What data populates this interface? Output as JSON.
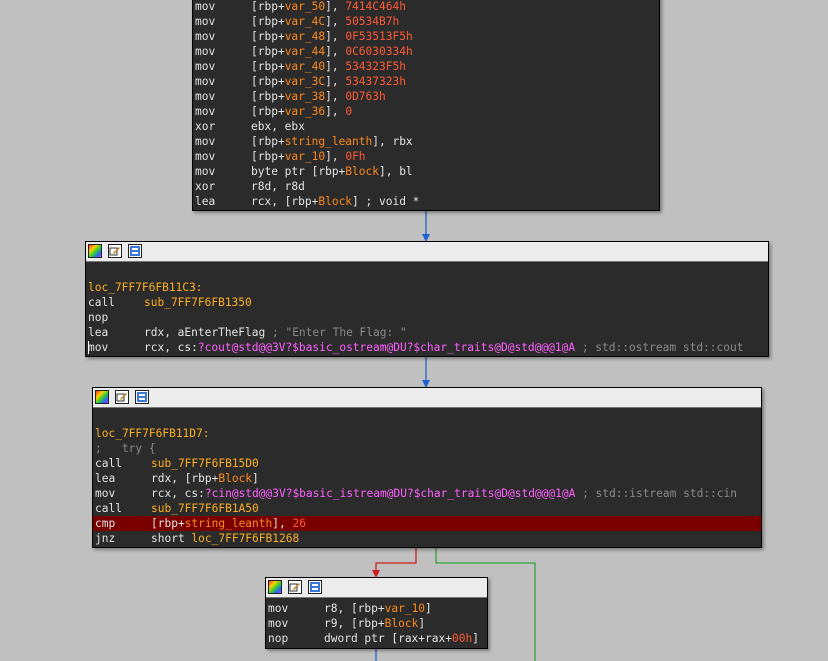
{
  "colors": {
    "background": "#c0c0c0",
    "block": "#2b2b2b",
    "edge_normal": "#1e62d0",
    "edge_false": "#cc1f1f",
    "edge_true": "#2fa43a",
    "highlight": "#7a0000"
  },
  "header_icons": [
    "graph-colors-icon",
    "edit-node-icon",
    "group-nodes-icon"
  ],
  "block1": {
    "lines": [
      {
        "mnem": "mov",
        "operands": [
          {
            "t": "[rbp+",
            "c": "op"
          },
          {
            "t": "var_50",
            "c": "var"
          },
          {
            "t": "], ",
            "c": "op"
          },
          {
            "t": "7414C464h",
            "c": "num"
          }
        ]
      },
      {
        "mnem": "mov",
        "operands": [
          {
            "t": "[rbp+",
            "c": "op"
          },
          {
            "t": "var_4C",
            "c": "var"
          },
          {
            "t": "], ",
            "c": "op"
          },
          {
            "t": "50534B7h",
            "c": "num"
          }
        ]
      },
      {
        "mnem": "mov",
        "operands": [
          {
            "t": "[rbp+",
            "c": "op"
          },
          {
            "t": "var_48",
            "c": "var"
          },
          {
            "t": "], ",
            "c": "op"
          },
          {
            "t": "0F53513F5h",
            "c": "num"
          }
        ]
      },
      {
        "mnem": "mov",
        "operands": [
          {
            "t": "[rbp+",
            "c": "op"
          },
          {
            "t": "var_44",
            "c": "var"
          },
          {
            "t": "], ",
            "c": "op"
          },
          {
            "t": "0C6030334h",
            "c": "num"
          }
        ]
      },
      {
        "mnem": "mov",
        "operands": [
          {
            "t": "[rbp+",
            "c": "op"
          },
          {
            "t": "var_40",
            "c": "var"
          },
          {
            "t": "], ",
            "c": "op"
          },
          {
            "t": "534323F5h",
            "c": "num"
          }
        ]
      },
      {
        "mnem": "mov",
        "operands": [
          {
            "t": "[rbp+",
            "c": "op"
          },
          {
            "t": "var_3C",
            "c": "var"
          },
          {
            "t": "], ",
            "c": "op"
          },
          {
            "t": "53437323h",
            "c": "num"
          }
        ]
      },
      {
        "mnem": "mov",
        "operands": [
          {
            "t": "[rbp+",
            "c": "op"
          },
          {
            "t": "var_38",
            "c": "var"
          },
          {
            "t": "], ",
            "c": "op"
          },
          {
            "t": "0D763h",
            "c": "num"
          }
        ]
      },
      {
        "mnem": "mov",
        "operands": [
          {
            "t": "[rbp+",
            "c": "op"
          },
          {
            "t": "var_36",
            "c": "var"
          },
          {
            "t": "], ",
            "c": "op"
          },
          {
            "t": "0",
            "c": "num"
          }
        ]
      },
      {
        "mnem": "xor",
        "operands": [
          {
            "t": "ebx, ebx",
            "c": "op"
          }
        ]
      },
      {
        "mnem": "mov",
        "operands": [
          {
            "t": "[rbp+",
            "c": "op"
          },
          {
            "t": "string_leanth",
            "c": "var"
          },
          {
            "t": "], rbx",
            "c": "op"
          }
        ]
      },
      {
        "mnem": "mov",
        "operands": [
          {
            "t": "[rbp+",
            "c": "op"
          },
          {
            "t": "var_10",
            "c": "var"
          },
          {
            "t": "], ",
            "c": "op"
          },
          {
            "t": "0Fh",
            "c": "num"
          }
        ]
      },
      {
        "mnem": "mov",
        "operands": [
          {
            "t": "byte ptr [rbp+",
            "c": "op"
          },
          {
            "t": "Block",
            "c": "var"
          },
          {
            "t": "], bl",
            "c": "op"
          }
        ]
      },
      {
        "mnem": "xor",
        "operands": [
          {
            "t": "r8d, r8d",
            "c": "op"
          }
        ]
      },
      {
        "mnem": "lea",
        "operands": [
          {
            "t": "rcx, [rbp+",
            "c": "op"
          },
          {
            "t": "Block",
            "c": "var"
          },
          {
            "t": "] ; void *",
            "c": "op"
          }
        ]
      }
    ]
  },
  "block2": {
    "label": "loc_7FF7F6FB11C3:",
    "lines": [
      {
        "mnem": "call",
        "operands": [
          {
            "t": "sub_7FF7F6FB1350",
            "c": "lbl"
          }
        ]
      },
      {
        "mnem": "nop",
        "operands": []
      },
      {
        "mnem": "lea",
        "operands": [
          {
            "t": "rdx, aEnterTheFlag ",
            "c": "op"
          },
          {
            "t": "; \"Enter The Flag: \"",
            "c": "cmt"
          }
        ]
      },
      {
        "mnem": "mov",
        "caret": true,
        "operands": [
          {
            "t": "rcx, cs:",
            "c": "op"
          },
          {
            "t": "?cout@std@@3V?$basic_ostream@DU?$char_traits@D@std@@@1@A",
            "c": "imp"
          },
          {
            "t": " ; std::ostream std::cout",
            "c": "cmt"
          }
        ]
      }
    ]
  },
  "block3": {
    "label": "loc_7FF7F6FB11D7:",
    "try": ";   try {",
    "lines": [
      {
        "mnem": "call",
        "operands": [
          {
            "t": "sub_7FF7F6FB15D0",
            "c": "lbl"
          }
        ]
      },
      {
        "mnem": "lea",
        "operands": [
          {
            "t": "rdx, [rbp+",
            "c": "op"
          },
          {
            "t": "Block",
            "c": "var"
          },
          {
            "t": "]",
            "c": "op"
          }
        ]
      },
      {
        "mnem": "mov",
        "operands": [
          {
            "t": "rcx, cs:",
            "c": "op"
          },
          {
            "t": "?cin@std@@3V?$basic_istream@DU?$char_traits@D@std@@@1@A",
            "c": "imp"
          },
          {
            "t": " ; std::istream std::cin",
            "c": "cmt"
          }
        ]
      },
      {
        "mnem": "call",
        "operands": [
          {
            "t": "sub_7FF7F6FB1A50",
            "c": "lbl"
          }
        ]
      },
      {
        "mnem": "cmp",
        "highlight": true,
        "operands": [
          {
            "t": "[rbp+",
            "c": "op"
          },
          {
            "t": "string_leanth",
            "c": "var"
          },
          {
            "t": "], ",
            "c": "op"
          },
          {
            "t": "26",
            "c": "num"
          }
        ]
      },
      {
        "mnem": "jnz",
        "operands": [
          {
            "t": "short ",
            "c": "op"
          },
          {
            "t": "loc_7FF7F6FB1268",
            "c": "lbl"
          }
        ]
      }
    ]
  },
  "block4": {
    "lines": [
      {
        "mnem": "mov",
        "operands": [
          {
            "t": "r8, [rbp+",
            "c": "op"
          },
          {
            "t": "var_10",
            "c": "var"
          },
          {
            "t": "]",
            "c": "op"
          }
        ]
      },
      {
        "mnem": "mov",
        "operands": [
          {
            "t": "r9, [rbp+",
            "c": "op"
          },
          {
            "t": "Block",
            "c": "var"
          },
          {
            "t": "]",
            "c": "op"
          }
        ]
      },
      {
        "mnem": "nop",
        "operands": [
          {
            "t": "dword ptr [rax+rax+",
            "c": "op"
          },
          {
            "t": "00h",
            "c": "num"
          },
          {
            "t": "]",
            "c": "op"
          }
        ]
      }
    ]
  }
}
